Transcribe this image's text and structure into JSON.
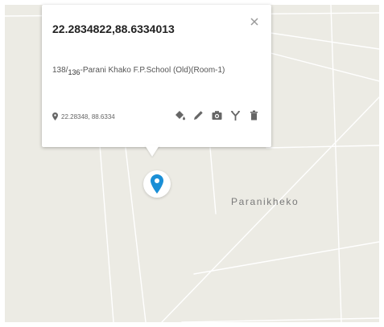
{
  "map": {
    "place_label": "Paranikheko",
    "colors": {
      "background": "#ecebe4",
      "road": "#ffffff",
      "marker": "#1a8fd6"
    }
  },
  "popup": {
    "title": "22.2834822,88.6334013",
    "description_prefix": "138/",
    "description_sub": "136",
    "description_rest": "-Parani Khako F.P.School (Old)(Room-1)",
    "coords_text": "22.28348, 88.6334",
    "close_label": "×",
    "icons": [
      "pin-icon",
      "paint-bucket-icon",
      "pencil-icon",
      "camera-icon",
      "fork-icon",
      "trash-icon"
    ]
  }
}
